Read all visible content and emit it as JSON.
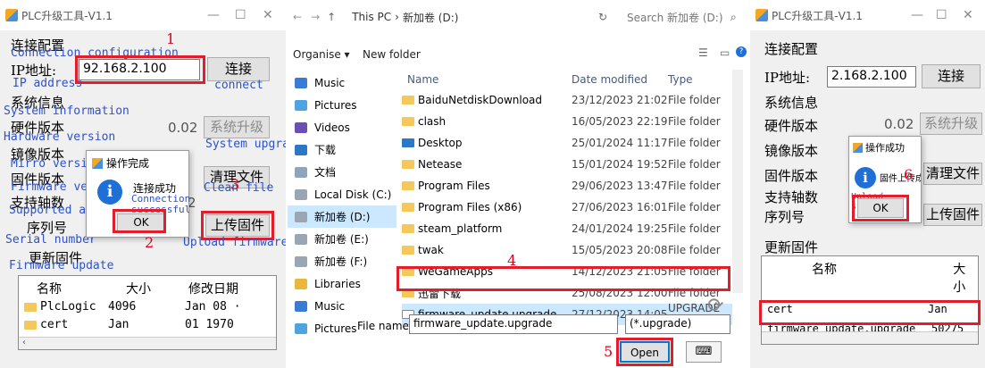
{
  "left": {
    "window_title": "PLC升级工具-V1.1",
    "sections": {
      "conn_cn": "连接配置",
      "conn_en": "Connection configuration",
      "sys_cn": "系统信息",
      "sys_en": "System information",
      "update_cn": "更新固件",
      "update_en": "Firmware update"
    },
    "ip_label_cn": "IP地址:",
    "ip_label_en": "IP address",
    "ip_value": "92.168.2.100",
    "connect_btn": "连接",
    "connect_en": "connect",
    "hw_cn": "硬件版本",
    "hw_en": "Hardware version",
    "hw_value": "0.02",
    "sysup_btn": "系统升级",
    "sysup_en": "System upgrade",
    "mirror_cn": "镜像版本",
    "mirror_en": "Mirro version",
    "fw_cn": "固件版本",
    "fw_en": "Firmware version",
    "clean_btn": "清理文件",
    "clean_en": "Clean file",
    "axis_cn": "支持轴数",
    "axis_en": "Supported axis",
    "axis_value": "2",
    "serial_cn": "序列号",
    "serial_en": "Serial number",
    "upload_btn": "上传固件",
    "upload_en": "Upload firmware",
    "dialog": {
      "title": "操作完成",
      "message": "连接成功",
      "msg_en": "Connection successful",
      "ok": "OK"
    },
    "list": {
      "col_name": "名称",
      "col_size": "大小",
      "col_date": "修改日期",
      "rows": [
        {
          "name": "PlcLogic",
          "size": "4096",
          "date": "Jan 08 ·"
        },
        {
          "name": "cert",
          "size": "Jan",
          "date": "01  1970"
        }
      ]
    },
    "steps": [
      "1",
      "2",
      "3"
    ]
  },
  "explorer": {
    "breadcrumb": [
      "This PC",
      "新加卷 (D:)"
    ],
    "search_placeholder": "Search 新加卷 (D:)",
    "organise": "Organise ▾",
    "new_folder": "New folder",
    "columns": {
      "name": "Name",
      "date": "Date modified",
      "type": "Type"
    },
    "sidebar": [
      "Music",
      "Pictures",
      "Videos",
      "下载",
      "文档",
      "Local Disk (C:)",
      "新加卷 (D:)",
      "新加卷 (E:)",
      "新加卷 (F:)",
      "Libraries",
      "Music",
      "Pictures"
    ],
    "files": [
      {
        "name": "BaiduNetdiskDownload",
        "date": "23/12/2023 21:02",
        "type": "File folder"
      },
      {
        "name": "clash",
        "date": "16/05/2023 22:19",
        "type": "File folder"
      },
      {
        "name": "Desktop",
        "date": "25/01/2024 11:17",
        "type": "File folder"
      },
      {
        "name": "Netease",
        "date": "15/01/2024 19:52",
        "type": "File folder"
      },
      {
        "name": "Program Files",
        "date": "29/06/2023 13:47",
        "type": "File folder"
      },
      {
        "name": "Program Files (x86)",
        "date": "27/06/2023 16:01",
        "type": "File folder"
      },
      {
        "name": "steam_platform",
        "date": "24/01/2024 19:25",
        "type": "File folder"
      },
      {
        "name": "twak",
        "date": "15/05/2023 20:08",
        "type": "File folder"
      },
      {
        "name": "WeGameApps",
        "date": "14/12/2023 21:05",
        "type": "File folder"
      },
      {
        "name": "迅雷下载",
        "date": "25/08/2023 12:00",
        "type": "File folder"
      },
      {
        "name": "firmware_update.upgrade",
        "date": "27/12/2023 14:05",
        "type": "UPGRADE File"
      }
    ],
    "filename_label": "File name:",
    "filename_value": "firmware_update.upgrade",
    "filter": "(*.upgrade)",
    "open_btn": "Open",
    "steps": [
      "4",
      "5"
    ]
  },
  "right": {
    "window_title": "PLC升级工具-V1.1",
    "sections": {
      "conn": "连接配置",
      "sys": "系统信息",
      "update": "更新固件"
    },
    "ip_label": "IP地址:",
    "ip_value": "2.168.2.100",
    "connect_btn": "连接",
    "hw_label": "硬件版本",
    "hw_value": "0.02",
    "sysup_btn": "系统升级",
    "mirror_label": "镜像版本",
    "fw_label": "固件版本",
    "clean_btn": "清理文件",
    "axis_label": "支持轴数",
    "serial_label": "序列号",
    "upload_btn": "上传固件",
    "dialog": {
      "title": "操作成功",
      "message": "固件上传成功",
      "msg_en": "Upload successful",
      "ok": "OK"
    },
    "list": {
      "col_name": "名称",
      "col_size": "大小",
      "rows": [
        {
          "name": "cert",
          "size": "Jan"
        },
        {
          "name": "firmware_update.upgrade",
          "size": "50275"
        }
      ]
    },
    "step": "6"
  }
}
